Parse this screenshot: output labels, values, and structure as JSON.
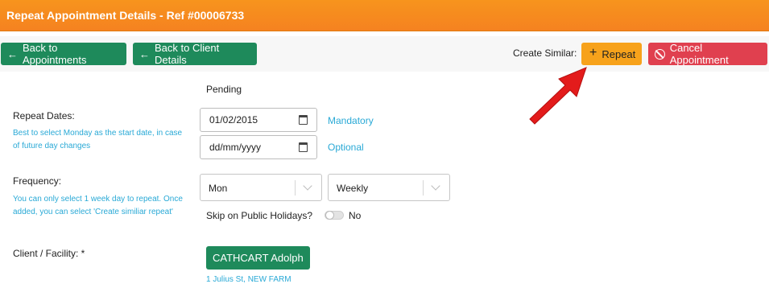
{
  "header": {
    "title": "Repeat Appointment Details - Ref #00006733"
  },
  "toolbar": {
    "back_appointments": "Back to Appointments",
    "back_client": "Back to Client Details",
    "create_similar": "Create Similar:",
    "repeat": "Repeat",
    "cancel": "Cancel Appointment"
  },
  "status": "Pending",
  "repeat_dates": {
    "label": "Repeat Dates:",
    "hint_line1": "Best to select Monday as the start date, in case",
    "hint_line2": "of future day changes",
    "date1": "01/02/2015",
    "date1_tag": "Mandatory",
    "date2": "dd/mm/yyyy",
    "date2_tag": "Optional"
  },
  "frequency": {
    "label": "Frequency:",
    "hint_line1": "You can only select 1 week day to repeat. Once",
    "hint_line2": "added, you can select 'Create similiar repeat'",
    "day": "Mon",
    "period": "Weekly",
    "skip_label": "Skip on Public Holidays?",
    "skip_value": "No"
  },
  "client": {
    "label": "Client / Facility: *",
    "name": "CATHCART Adolph",
    "address": "1 Julius St, NEW FARM"
  },
  "colors": {
    "header": "#f58220",
    "green": "#1e8a5b",
    "orange": "#f7a21b",
    "red": "#e0404f",
    "link": "#29a9d6",
    "arrow": "#e31b1b"
  }
}
